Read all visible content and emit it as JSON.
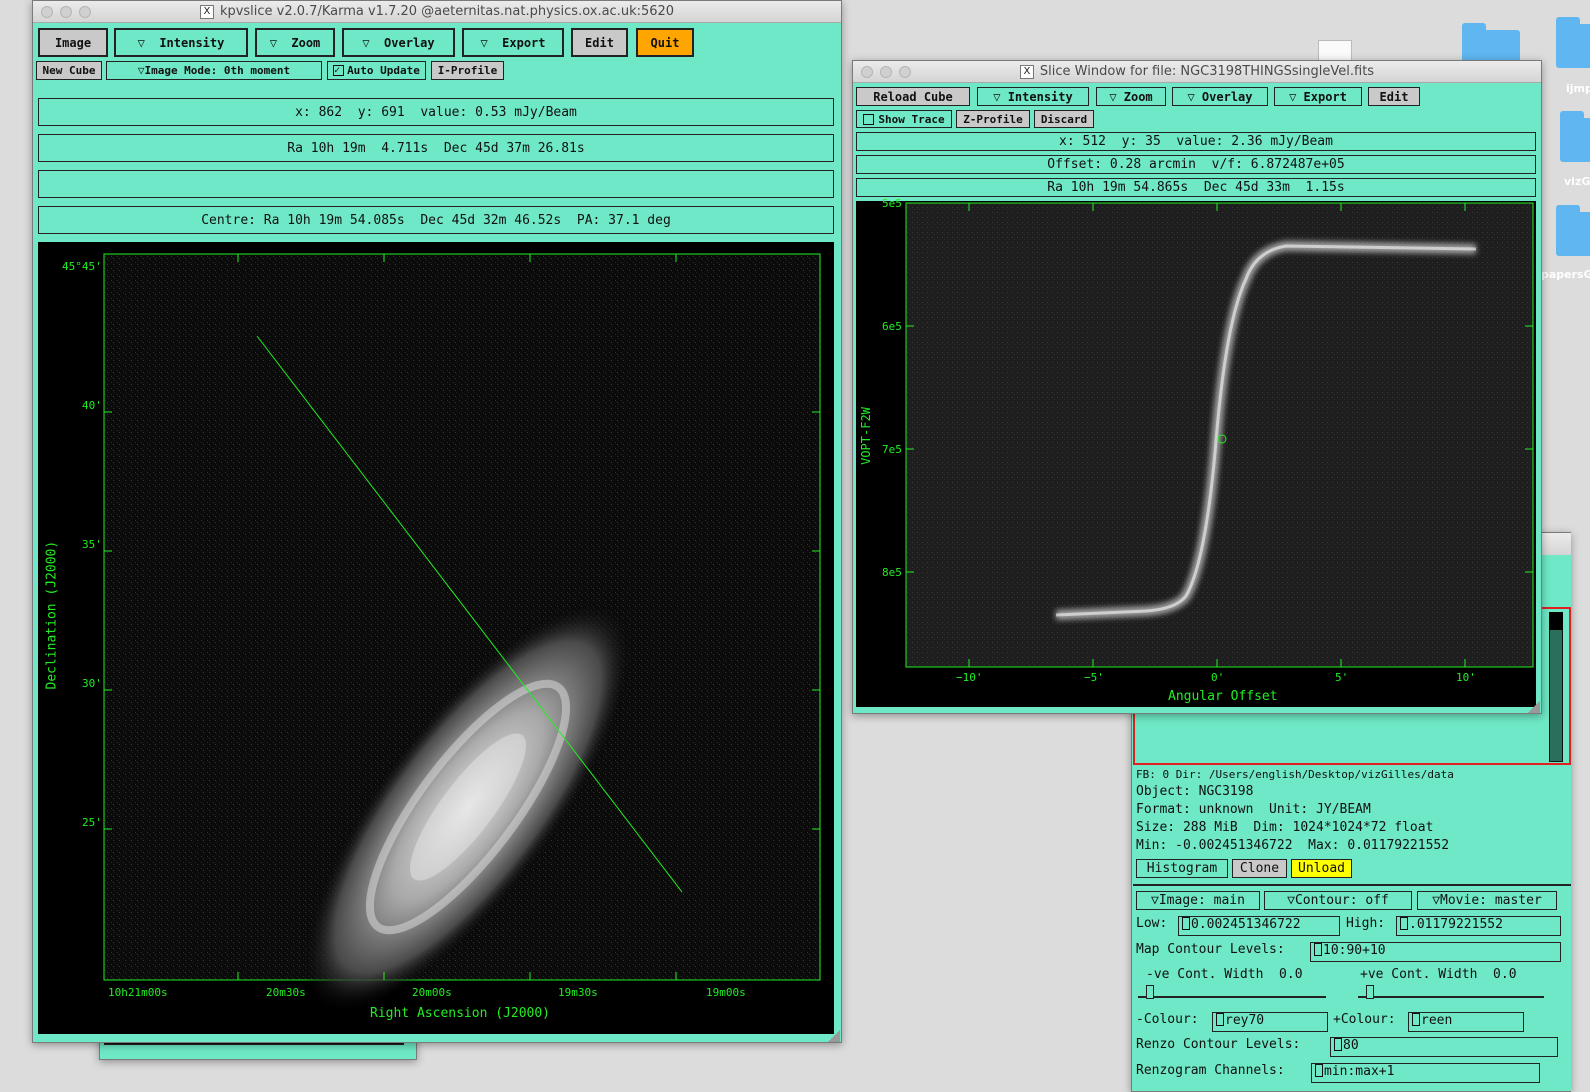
{
  "desktop": {
    "icons": [
      {
        "label": "ijmp"
      },
      {
        "label": "vizG"
      },
      {
        "label": "papersG"
      }
    ]
  },
  "main": {
    "title": "kpvslice v2.0.7/Karma v1.7.20 @aeternitas.nat.physics.ox.ac.uk:5620",
    "buttons": {
      "image": "Image",
      "intensity": "▽  Intensity",
      "zoom": "▽  Zoom",
      "overlay": "▽  Overlay",
      "export": "▽  Export",
      "edit": "Edit",
      "quit": "Quit"
    },
    "row2": {
      "new_cube": "New Cube",
      "image_mode": "▽Image Mode: 0th moment",
      "auto_update": "Auto Update",
      "i_profile": "I-Profile"
    },
    "info": {
      "xy": "x: 862  y: 691  value: 0.53 mJy/Beam",
      "radec": "Ra 10h 19m  4.711s  Dec 45d 37m 26.81s",
      "blank": "",
      "centre": "Centre: Ra 10h 19m 54.085s  Dec 45d 32m 46.52s  PA: 37.1 deg"
    },
    "plot": {
      "ylabel": "Declination (J2000)",
      "xlabel": "Right Ascension (J2000)",
      "yticks": [
        "45°45'",
        "40'",
        "35'",
        "30'",
        "25'"
      ],
      "xticks": [
        "10h21m00s",
        "20m30s",
        "20m00s",
        "19m30s",
        "19m00s"
      ]
    }
  },
  "slice": {
    "title": "Slice Window for file: NGC3198THINGSsingleVel.fits",
    "buttons": {
      "reload": "Reload Cube",
      "intensity": "▽ Intensity",
      "zoom": "▽ Zoom",
      "overlay": "▽ Overlay",
      "export": "▽ Export",
      "edit": "Edit"
    },
    "row2": {
      "show_trace": "Show Trace",
      "z_profile": "Z-Profile",
      "discard": "Discard"
    },
    "info": {
      "xy": "x: 512  y: 35  value: 2.36 mJy/Beam",
      "offset": "Offset: 0.28 arcmin  v/f: 6.872487e+05",
      "radec": "Ra 10h 19m 54.865s  Dec 45d 33m  1.15s"
    },
    "plot": {
      "ylabel": "VOPT-F2W",
      "xlabel": "Angular Offset",
      "yticks": [
        "5e5",
        "6e5",
        "7e5",
        "8e5"
      ],
      "xticks": [
        "−10'",
        "−5'",
        "0'",
        "5'",
        "10'"
      ]
    }
  },
  "panel": {
    "fb_line": "FB: 0 Dir: /Users/english/Desktop/vizGilles/data",
    "object": "Object: NGC3198",
    "format": "Format: unknown  Unit: JY/BEAM",
    "size": "Size: 288 MiB  Dim: 1024*1024*72 float",
    "minmax": "Min: -0.002451346722  Max: 0.01179221552",
    "histogram": "Histogram",
    "clone": "Clone",
    "unload": "Unload",
    "image_menu": "▽Image: main",
    "contour_menu": "▽Contour: off",
    "movie_menu": "▽Movie: master",
    "low_label": "Low:",
    "low_value": "0.002451346722",
    "high_label": "High:",
    "high_value": ".01179221552",
    "map_levels_label": "Map Contour Levels:",
    "map_levels": "10:90+10",
    "neg_width": "-ve Cont. Width  0.0",
    "pos_width": "+ve Cont. Width  0.0",
    "neg_colour_label": "-Colour:",
    "neg_colour": "rey70",
    "pos_colour_label": "+Colour:",
    "pos_colour": "reen",
    "renzo_label": "Renzo Contour Levels:",
    "renzo": "80",
    "renzogram_label": "Renzogram Channels:",
    "renzogram": "min:max+1"
  },
  "colors": {
    "panel": "#6ee8c6",
    "axis": "#22ee22",
    "quit": "#ffa500",
    "unload": "#ffff00",
    "highlight": "#ff2020"
  }
}
